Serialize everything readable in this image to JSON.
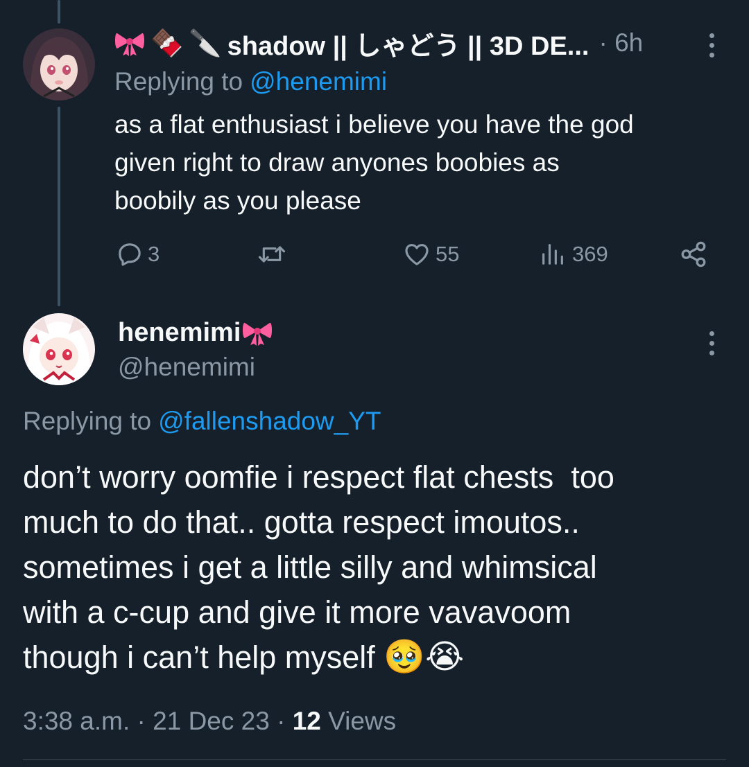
{
  "reply_tweet": {
    "name_emojis": [
      "bow",
      "🍫",
      "🔪"
    ],
    "display_name": "shadow || しゃどう || 3D DE...",
    "time": "· 6h",
    "replying_prefix": "Replying to",
    "replying_handle": "@henemimi",
    "text": "as a flat enthusiast i believe you have the god\ngiven right to draw anyones boobies as\nboobily as you please",
    "actions": {
      "reply_count": "3",
      "retweet_count": "",
      "like_count": "55",
      "view_count": "369"
    }
  },
  "main_tweet": {
    "display_name": "henemimi",
    "handle": "@henemimi",
    "replying_prefix": "Replying to",
    "replying_handle": "@fallenshadow_YT",
    "text": "don’t worry oomfie i respect flat chests  too\nmuch to do that.. gotta respect imoutos..\nsometimes i get a little silly and whimsical\nwith a c-cup and give it more vavavoom\nthough i can’t help myself",
    "text_emojis": [
      "🥹",
      "😭"
    ],
    "timestamp": "3:38 a.m. · 21 Dec 23 · ",
    "views_count": "12",
    "views_label": " Views"
  },
  "colors": {
    "background": "#15202b",
    "text": "#f7f9f9",
    "muted": "#8b98a5",
    "link": "#1d9bf0",
    "bow_pink": "#ff5f9e",
    "thread_line": "#3d5466"
  }
}
